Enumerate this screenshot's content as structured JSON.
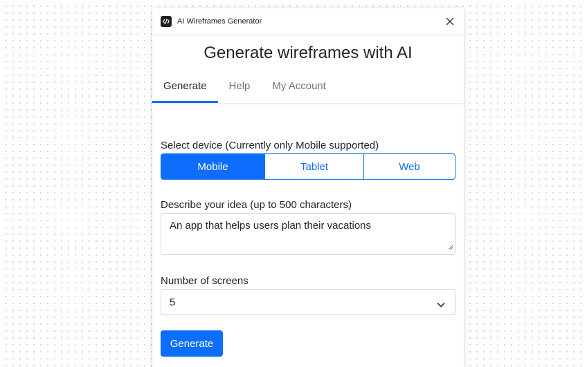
{
  "window": {
    "title": "AI Wireframes Generator",
    "app_icon": "code-icon",
    "close_icon": "close-icon"
  },
  "heading": "Generate wireframes with AI",
  "tabs": [
    {
      "label": "Generate",
      "active": true
    },
    {
      "label": "Help",
      "active": false
    },
    {
      "label": "My Account",
      "active": false
    }
  ],
  "form": {
    "device_label": "Select device (Currently only Mobile supported)",
    "devices": [
      {
        "label": "Mobile",
        "selected": true
      },
      {
        "label": "Tablet",
        "selected": false
      },
      {
        "label": "Web",
        "selected": false
      }
    ],
    "idea_label": "Describe your idea (up to 500 characters)",
    "idea_value": "An app that helps users plan their vacations",
    "screens_label": "Number of screens",
    "screens_value": "5",
    "submit_label": "Generate"
  },
  "colors": {
    "accent": "#0d6efd",
    "text": "#212529",
    "muted": "#6c757d"
  }
}
